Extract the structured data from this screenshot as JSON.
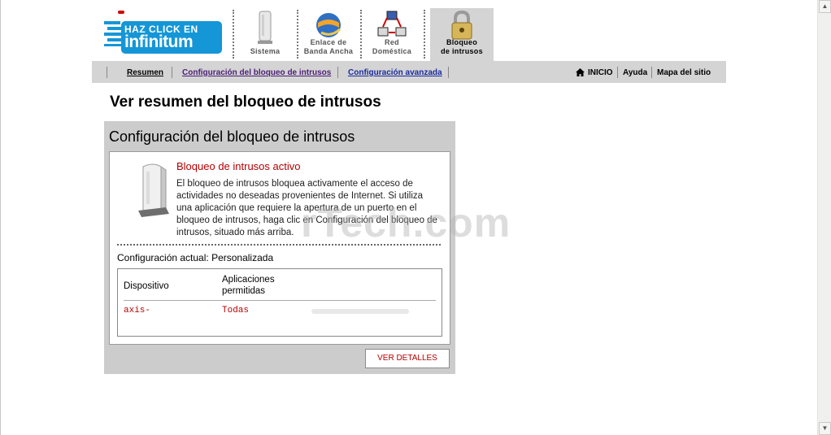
{
  "logo": {
    "line1": "HAZ CLICK EN",
    "line2": "infinitum"
  },
  "nav_tabs": [
    {
      "line1": "Sistema",
      "line2": "",
      "icon": "router-icon",
      "active": false
    },
    {
      "line1": "Enlace de",
      "line2": "Banda Ancha",
      "icon": "globe-icon",
      "active": false
    },
    {
      "line1": "Red",
      "line2": "Doméstica",
      "icon": "network-icon",
      "active": false
    },
    {
      "line1": "Bloqueo",
      "line2": "de intrusos",
      "icon": "padlock-icon",
      "active": true
    }
  ],
  "subnav": {
    "resumen": "Resumen",
    "config_bloqueo": "Configuración del bloqueo de intrusos",
    "config_avanzada": "Configuración avanzada",
    "inicio": "INICIO",
    "ayuda": "Ayuda",
    "mapa": "Mapa del sitio"
  },
  "page_title": "Ver resumen del bloqueo de intrusos",
  "panel": {
    "title": "Configuración del bloqueo de intrusos",
    "status_title": "Bloqueo de intrusos activo",
    "description": "El bloqueo de intrusos bloquea activamente el acceso de actividades no deseadas provenientes de Internet. Si utiliza una aplicación que requiere la apertura de un puerto en el bloqueo de intrusos, haga clic en Configuración del bloqueo de intrusos, situado más arriba.",
    "current_config": "Configuración actual: Personalizada",
    "table": {
      "headers": [
        "Dispositivo",
        "Aplicaciones permitidas"
      ],
      "rows": [
        {
          "device": "axis-",
          "apps": "Todas"
        }
      ]
    },
    "details_button": "VER DETALLES"
  },
  "watermark": "rTech.com",
  "colors": {
    "accent_red": "#b30000",
    "nav_gray": "#d4d4d4",
    "logo_blue": "#1596d6"
  }
}
